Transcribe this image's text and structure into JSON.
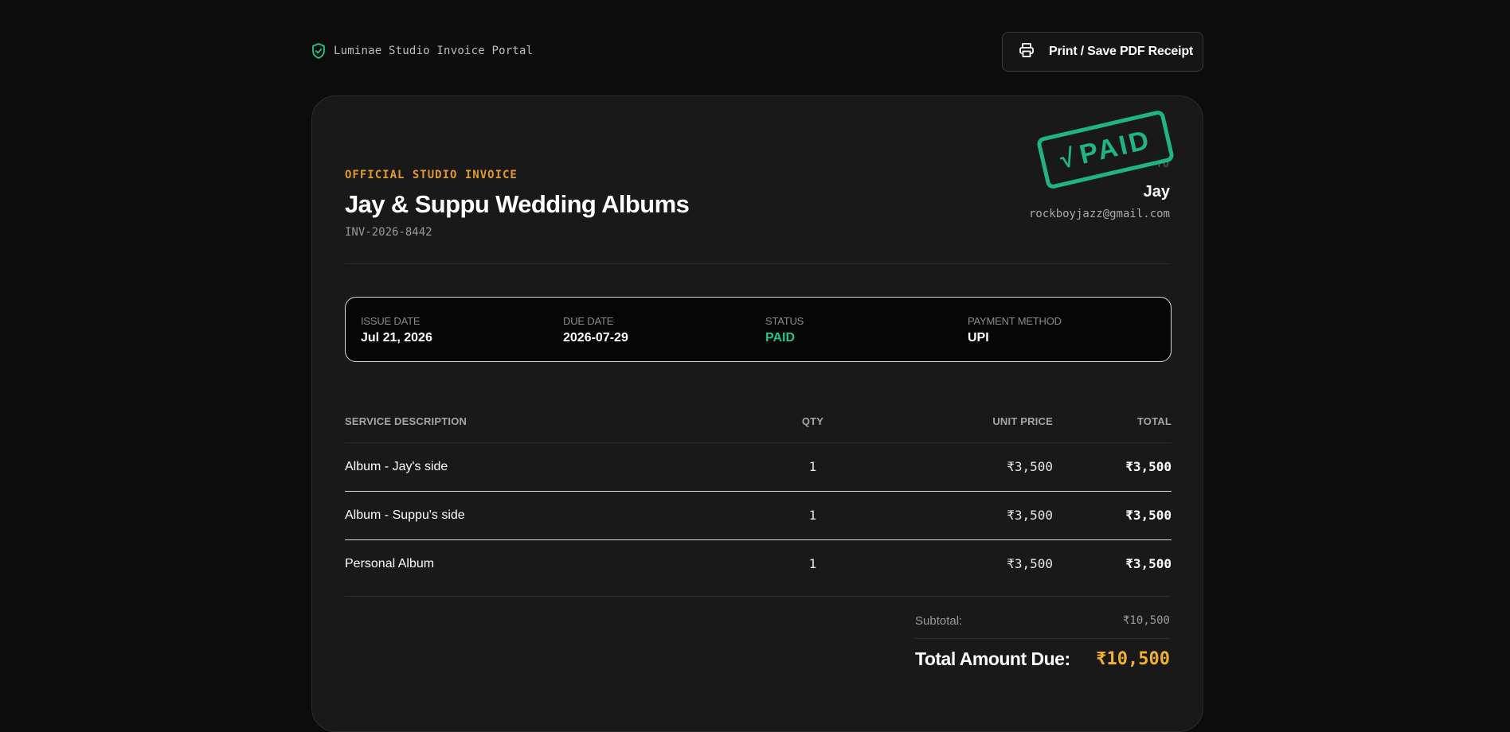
{
  "header": {
    "brand_text": "Luminae Studio Invoice Portal",
    "brand_icon": "shield-check-icon",
    "print_button_label": "Print / Save PDF Receipt",
    "print_icon": "printer-icon"
  },
  "invoice": {
    "eyebrow": "OFFICIAL STUDIO INVOICE",
    "title": "Jay & Suppu Wedding Albums",
    "number": "INV-2026-8442",
    "stamp": {
      "check": "√",
      "text": "PAID",
      "color": "#1fb386"
    }
  },
  "bill_to": {
    "label": "TO",
    "name": "Jay",
    "email": "rockboyjazz@gmail.com"
  },
  "meta": {
    "issue_date_label": "ISSUE DATE",
    "issue_date": "Jul 21, 2026",
    "due_date_label": "DUE DATE",
    "due_date": "2026-07-29",
    "status_label": "STATUS",
    "status": "PAID",
    "status_color": "#22c48f",
    "payment_method_label": "PAYMENT METHOD",
    "payment_method": "UPI"
  },
  "table": {
    "headers": {
      "description": "SERVICE DESCRIPTION",
      "qty": "QTY",
      "unit_price": "UNIT PRICE",
      "total": "TOTAL"
    },
    "rows": [
      {
        "description": "Album - Jay's side",
        "qty": "1",
        "unit_price": "₹3,500",
        "total": "₹3,500"
      },
      {
        "description": "Album - Suppu's side",
        "qty": "1",
        "unit_price": "₹3,500",
        "total": "₹3,500"
      },
      {
        "description": "Personal Album",
        "qty": "1",
        "unit_price": "₹3,500",
        "total": "₹3,500"
      }
    ]
  },
  "totals": {
    "subtotal_label": "Subtotal:",
    "subtotal_value": "₹10,500",
    "total_label": "Total Amount Due:",
    "total_value": "₹10,500",
    "total_color": "#f0b030"
  }
}
